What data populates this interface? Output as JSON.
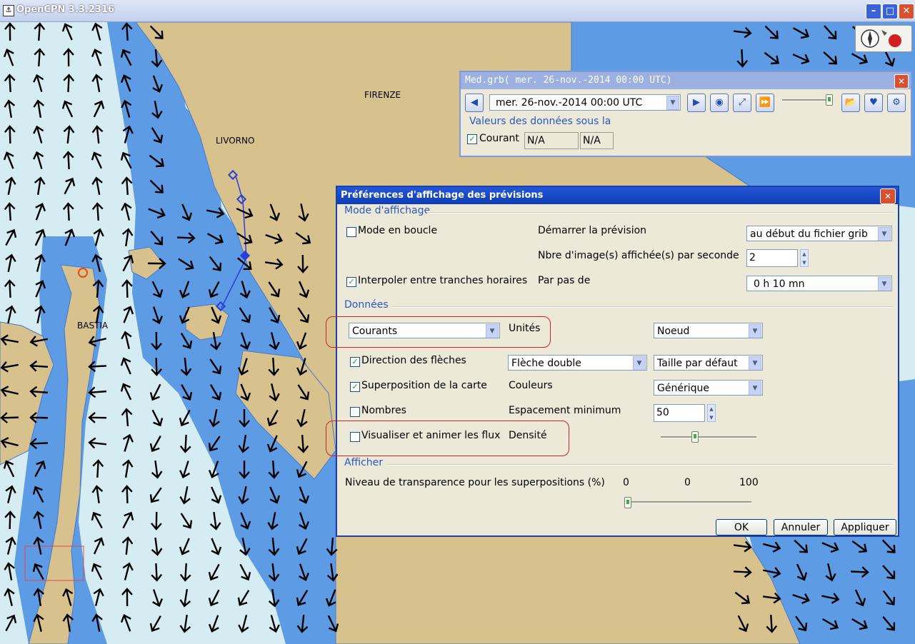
{
  "window": {
    "title": "OpenCPN 3.3.2316",
    "app_icon": "opencpn-icon",
    "buttons": [
      "minimize",
      "maximize",
      "close"
    ]
  },
  "map": {
    "labels": {
      "firenze": "FIRENZE",
      "livorno": "LIVORNO",
      "bastia": "BASTIA"
    },
    "colors": {
      "land": "#d7c28e",
      "shallow": "#5d9ce4",
      "deep": "#d6ecf3",
      "arrow": "#000000"
    },
    "icon": "current-arrows-overlay"
  },
  "grib": {
    "title": "Med.grb( mer. 26-nov.-2014 00:00  UTC)",
    "timestamp": "mer. 26-nov.-2014 00:00  UTC",
    "data_header": "Valeurs des données sous la",
    "courant_label": "Courant",
    "courant_checked": true,
    "value1": "N/A",
    "value2": "N/A",
    "icons": [
      "prev-icon",
      "next-icon",
      "now-icon",
      "zoom-icon",
      "play-icon",
      "open-file-icon",
      "settings-icon",
      "request-icon"
    ]
  },
  "prefs": {
    "title": "Préférences d'affichage des prévisions",
    "display_mode": {
      "section": "Mode d'affichage",
      "loop_label": "Mode en boucle",
      "loop_checked": false,
      "start_label": "Démarrer la prévision",
      "start_value": "au début du fichier grib",
      "fps_label": "Nbre d'image(s) affichée(s) par seconde",
      "fps_value": "2",
      "interp_label": "Interpoler entre tranches horaires",
      "interp_checked": true,
      "step_label": "Par pas de",
      "step_value": "0 h 10 mn"
    },
    "data": {
      "section": "Données",
      "type_value": "Courants",
      "units_label": "Unités",
      "units_value": "Noeud",
      "arrows_label": "Direction des flèches",
      "arrows_checked": true,
      "arrow_type": "Flèche double",
      "arrow_size": "Taille par défaut",
      "overlay_label": "Superposition de la carte",
      "overlay_checked": true,
      "colors_label": "Couleurs",
      "colors_value": "Générique",
      "numbers_label": "Nombres",
      "numbers_checked": false,
      "spacing_label": "Espacement minimum",
      "spacing_value": "50",
      "particles_label": "Visualiser et animer les flux",
      "particles_checked": false,
      "density_label": "Densité",
      "density_level": 0.35
    },
    "display": {
      "section": "Afficher",
      "transparency_label": "Niveau de transparence pour les superpositions (%)",
      "min": "0",
      "value": "0",
      "max": "100",
      "level": 0
    },
    "buttons": {
      "ok": "OK",
      "cancel": "Annuler",
      "apply": "Appliquer"
    }
  }
}
